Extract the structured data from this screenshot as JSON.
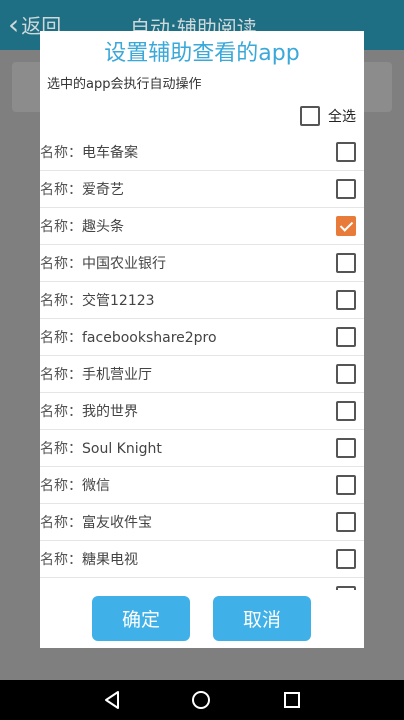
{
  "background_app": {
    "back_label": "返回",
    "title": "自动:辅助阅读"
  },
  "dialog": {
    "title": "设置辅助查看的app",
    "subtitle": "选中的app会执行自动操作",
    "select_all_label": "全选",
    "select_all_checked": false,
    "items": [
      {
        "prefix": "名称：",
        "name": "电车备案",
        "checked": false
      },
      {
        "prefix": "名称：",
        "name": "爱奇艺",
        "checked": false
      },
      {
        "prefix": "名称：",
        "name": "趣头条",
        "checked": true
      },
      {
        "prefix": "名称：",
        "name": "中国农业银行",
        "checked": false
      },
      {
        "prefix": "名称：",
        "name": "交管12123",
        "checked": false
      },
      {
        "prefix": "名称：",
        "name": "facebookshare2pro",
        "checked": false
      },
      {
        "prefix": "名称：",
        "name": "手机营业厅",
        "checked": false
      },
      {
        "prefix": "名称：",
        "name": "我的世界",
        "checked": false
      },
      {
        "prefix": "名称：",
        "name": "Soul Knight",
        "checked": false
      },
      {
        "prefix": "名称：",
        "name": "微信",
        "checked": false
      },
      {
        "prefix": "名称：",
        "name": "富友收件宝",
        "checked": false
      },
      {
        "prefix": "名称：",
        "name": "糖果电视",
        "checked": false
      },
      {
        "prefix": "",
        "name": "",
        "checked": false
      }
    ],
    "ok_label": "确定",
    "cancel_label": "取消"
  },
  "colors": {
    "accent": "#3aa8d8",
    "button": "#3fb0e8",
    "checked": "#e87b3a"
  },
  "navbar": {
    "icons": [
      "back-triangle-icon",
      "home-circle-icon",
      "recent-square-icon"
    ]
  }
}
